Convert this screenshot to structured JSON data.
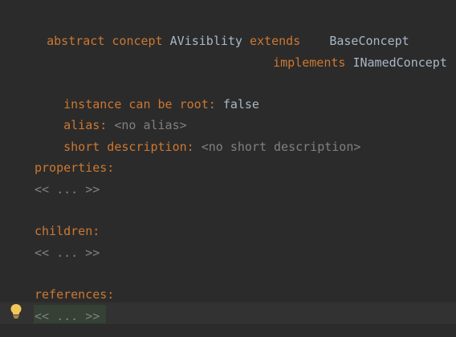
{
  "concept": {
    "kw_abstract": "abstract",
    "kw_concept": "concept",
    "name": "AVisiblity",
    "kw_extends": "extends",
    "extends_value": "BaseConcept",
    "kw_implements": "implements",
    "implements_value": "INamedConcept"
  },
  "props": {
    "instance_label": "instance can be root:",
    "instance_value": "false",
    "alias_label": "alias:",
    "alias_value": "<no alias>",
    "short_label": "short description:",
    "short_value": "<no short description>"
  },
  "sections": {
    "properties_label": "properties:",
    "properties_value": "<< ... >>",
    "children_label": "children:",
    "children_value": "<< ... >>",
    "references_label": "references:",
    "references_value": "<< ... >>"
  },
  "colors": {
    "background": "#2b2b2b",
    "keyword": "#cc7832",
    "identifier": "#a9b7c6",
    "placeholder": "#808080",
    "bulb": "#f2c55c"
  },
  "icons": {
    "intention": "lightbulb-icon"
  }
}
